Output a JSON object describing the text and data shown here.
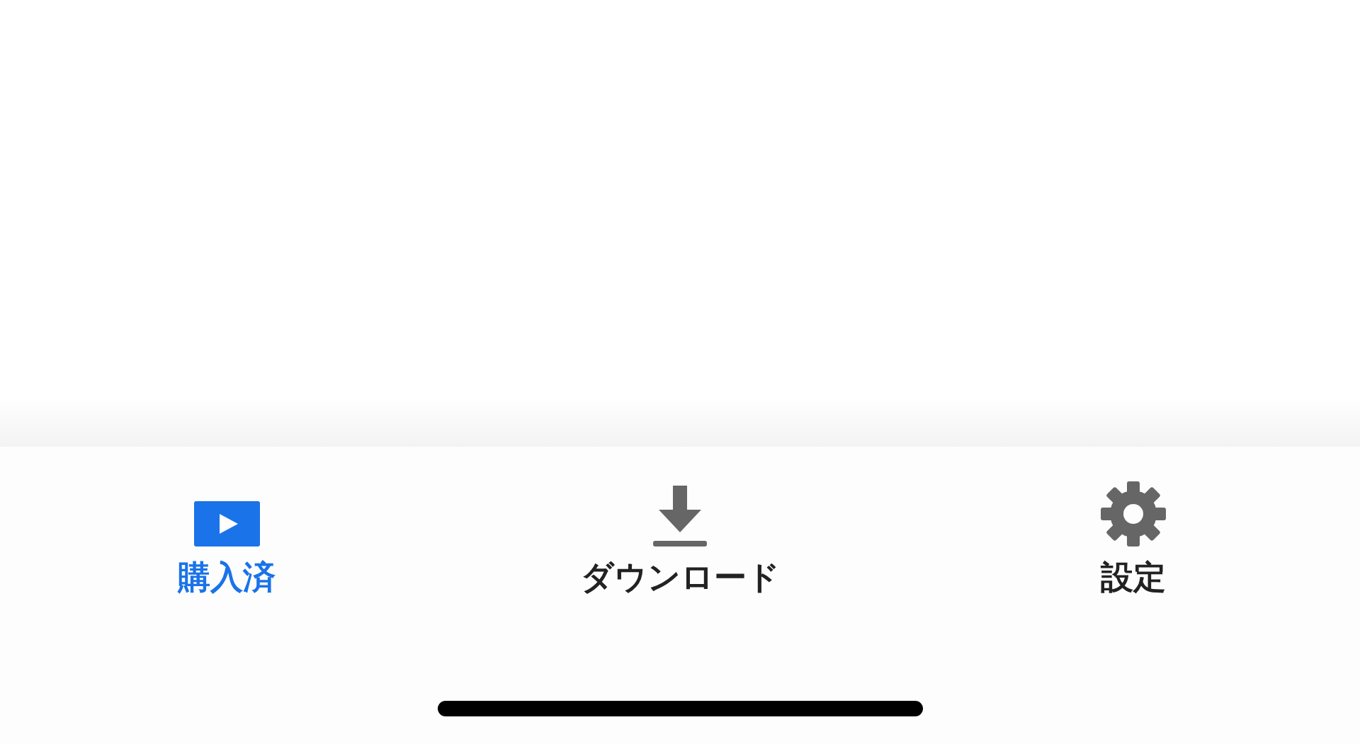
{
  "tabs": [
    {
      "kind": "play",
      "label": "購入済",
      "selected": true
    },
    {
      "kind": "download",
      "label": "ダウンロード",
      "selected": false
    },
    {
      "kind": "settings",
      "label": "設定",
      "selected": false
    }
  ]
}
